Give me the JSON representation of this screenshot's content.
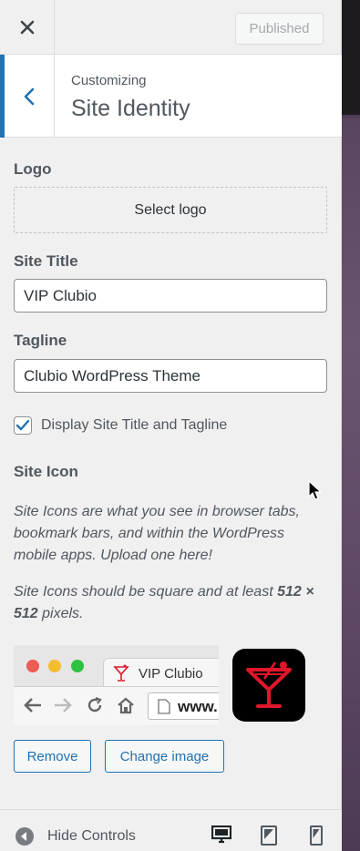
{
  "header": {
    "close_label": "close",
    "published_label": "Published"
  },
  "section": {
    "breadcrumb": "Customizing",
    "title": "Site Identity"
  },
  "logo": {
    "label": "Logo",
    "select_label": "Select logo"
  },
  "site_title": {
    "label": "Site Title",
    "value": "VIP Clubio"
  },
  "tagline": {
    "label": "Tagline",
    "value": "Clubio WordPress Theme"
  },
  "display_toggle": {
    "label": "Display Site Title and Tagline",
    "checked": true
  },
  "site_icon": {
    "label": "Site Icon",
    "desc1": "Site Icons are what you see in browser tabs, bookmark bars, and within the WordPress mobile apps. Upload one here!",
    "desc2_prefix": "Site Icons should be square and at least ",
    "desc2_size": "512 × 512",
    "desc2_suffix": " pixels.",
    "preview_tab_title": "VIP Clubio",
    "preview_url": "www.",
    "remove_label": "Remove",
    "change_label": "Change image"
  },
  "footer": {
    "hide_controls_label": "Hide Controls"
  },
  "colors": {
    "accent": "#2271b1",
    "icon_red": "#e0162b"
  }
}
